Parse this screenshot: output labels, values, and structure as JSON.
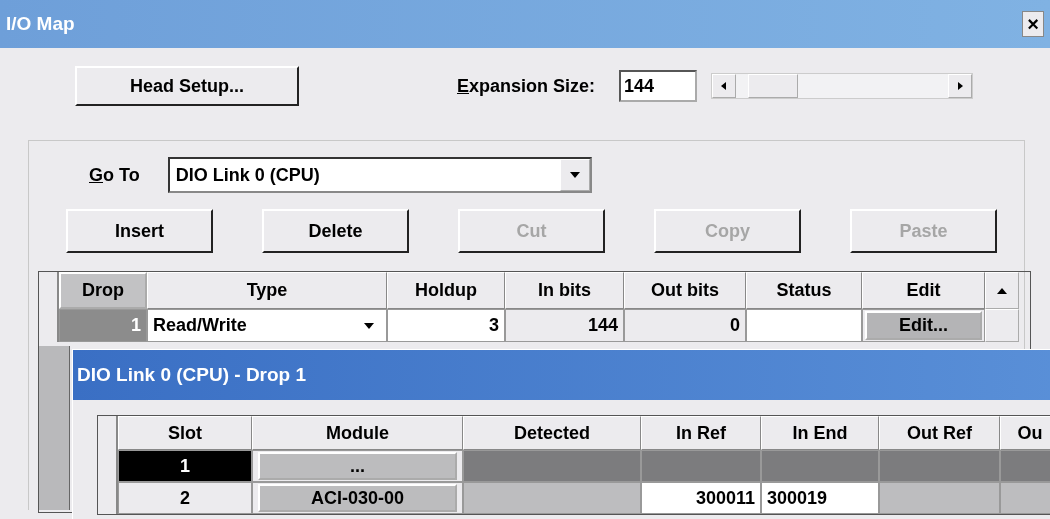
{
  "window": {
    "title": "I/O Map",
    "close": "×"
  },
  "head_setup_button": "Head Setup...",
  "expansion_size": {
    "access_key": "E",
    "label_rest": "xpansion Size:",
    "value": "144"
  },
  "go_to": {
    "access_key": "G",
    "label_rest": "o To",
    "value": "DIO Link 0 (CPU)"
  },
  "buttons": [
    {
      "label": "Insert",
      "disabled": false
    },
    {
      "label": "Delete",
      "disabled": false
    },
    {
      "label": "Cut",
      "disabled": true
    },
    {
      "label": "Copy",
      "disabled": true
    },
    {
      "label": "Paste",
      "disabled": true
    }
  ],
  "drop_table": {
    "columns": [
      "Drop",
      "Type",
      "Holdup",
      "In bits",
      "Out bits",
      "Status",
      "Edit"
    ],
    "rows": [
      {
        "drop": "1",
        "type": "Read/Write",
        "holdup": "3",
        "in_bits": "144",
        "out_bits": "0",
        "edit": "Edit...",
        "selected": true
      }
    ]
  },
  "child_window": {
    "title": "DIO Link 0 (CPU) - Drop 1",
    "columns": [
      "Slot",
      "Module",
      "Detected",
      "In Ref",
      "In End",
      "Out Ref",
      "Ou"
    ],
    "rows": [
      {
        "slot": "1",
        "module": "...",
        "kind": "blank",
        "selected": true
      },
      {
        "slot": "2",
        "module": "ACI-030-00",
        "in_ref": "300011",
        "in_end": "300019",
        "kind": "assigned",
        "selected": false
      }
    ]
  }
}
